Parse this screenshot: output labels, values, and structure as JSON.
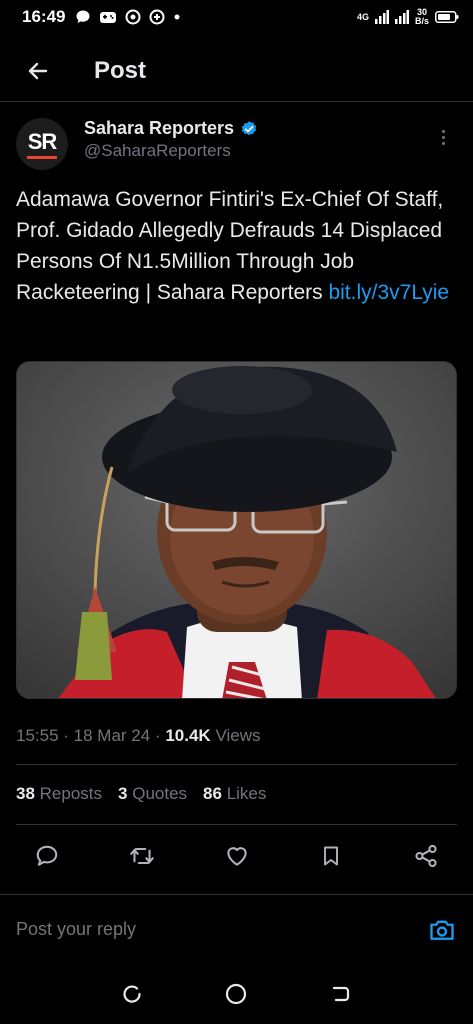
{
  "status_bar": {
    "time": "16:49",
    "network": "4G",
    "speed_value": "30",
    "speed_unit": "B/s"
  },
  "header": {
    "title": "Post"
  },
  "author": {
    "display_name": "Sahara Reporters",
    "handle": "@SaharaReporters",
    "avatar_text": "SR",
    "verified": true
  },
  "post": {
    "text": "Adamawa Governor Fintiri's Ex-Chief Of Staff, Prof. Gidado Allegedly Defrauds 14 Displaced Persons Of N1.5Million Through Job Racketeering | Sahara Reporters ",
    "link": "bit.ly/3v7Lyie",
    "time": "15:55",
    "date": "18 Mar 24",
    "views_count": "10.4K",
    "views_label": "Views"
  },
  "stats": {
    "reposts_count": "38",
    "reposts_label": "Reposts",
    "quotes_count": "3",
    "quotes_label": "Quotes",
    "likes_count": "86",
    "likes_label": "Likes"
  },
  "reply": {
    "placeholder": "Post your reply"
  },
  "colors": {
    "background": "#000000",
    "accent": "#1d9bf0",
    "muted": "#71767b",
    "text": "#e7e9ea"
  },
  "icons": {
    "back": "arrow-left-icon",
    "verified": "verified-badge-icon",
    "more": "more-vertical-icon",
    "reply": "comment-icon",
    "repost": "repost-icon",
    "like": "heart-icon",
    "bookmark": "bookmark-icon",
    "share": "share-icon",
    "camera": "camera-icon"
  }
}
